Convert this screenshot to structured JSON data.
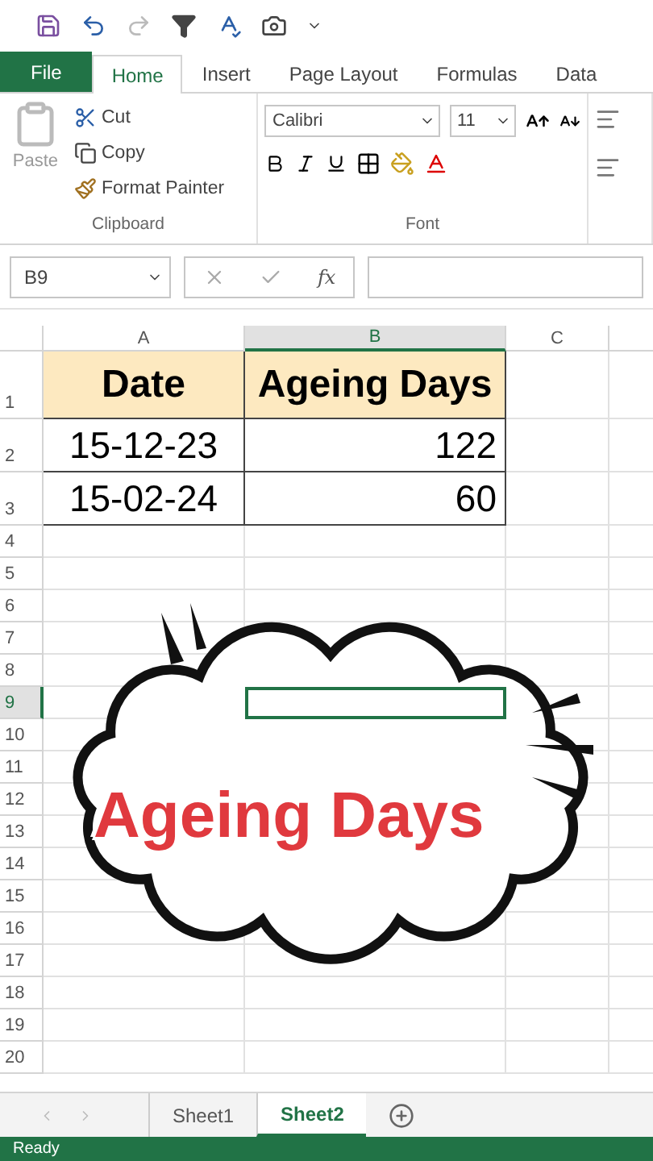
{
  "ribbon_tabs": [
    {
      "label": "File",
      "kind": "file",
      "selected": false
    },
    {
      "label": "Home",
      "kind": "tab",
      "selected": true
    },
    {
      "label": "Insert",
      "kind": "tab",
      "selected": false
    },
    {
      "label": "Page Layout",
      "kind": "tab",
      "selected": false
    },
    {
      "label": "Formulas",
      "kind": "tab",
      "selected": false
    },
    {
      "label": "Data",
      "kind": "tab",
      "selected": false
    }
  ],
  "clipboard": {
    "paste": "Paste",
    "cut": "Cut",
    "copy": "Copy",
    "format_painter": "Format Painter",
    "group": "Clipboard"
  },
  "font": {
    "name": "Calibri",
    "size": "11",
    "group": "Font"
  },
  "formula_bar": {
    "name_box": "B9",
    "function_label": "fx"
  },
  "columns": [
    {
      "label": "A",
      "selected": false
    },
    {
      "label": "B",
      "selected": true
    },
    {
      "label": "C",
      "selected": false
    }
  ],
  "rows": [
    {
      "number": "1",
      "selected": false,
      "kind": "header",
      "cells": [
        "Date",
        "Ageing Days"
      ]
    },
    {
      "number": "2",
      "selected": false,
      "kind": "data",
      "cells": [
        "15-12-23",
        "122"
      ]
    },
    {
      "number": "3",
      "selected": false,
      "kind": "data",
      "cells": [
        "15-02-24",
        "60"
      ]
    },
    {
      "number": "4",
      "selected": false,
      "kind": "empty"
    },
    {
      "number": "5",
      "selected": false,
      "kind": "empty"
    },
    {
      "number": "6",
      "selected": false,
      "kind": "empty"
    },
    {
      "number": "7",
      "selected": false,
      "kind": "empty"
    },
    {
      "number": "8",
      "selected": false,
      "kind": "empty"
    },
    {
      "number": "9",
      "selected": true,
      "kind": "empty"
    },
    {
      "number": "10",
      "selected": false,
      "kind": "empty"
    },
    {
      "number": "11",
      "selected": false,
      "kind": "empty"
    },
    {
      "number": "12",
      "selected": false,
      "kind": "empty"
    },
    {
      "number": "13",
      "selected": false,
      "kind": "empty"
    },
    {
      "number": "14",
      "selected": false,
      "kind": "empty"
    },
    {
      "number": "15",
      "selected": false,
      "kind": "empty"
    },
    {
      "number": "16",
      "selected": false,
      "kind": "empty"
    },
    {
      "number": "17",
      "selected": false,
      "kind": "empty"
    },
    {
      "number": "18",
      "selected": false,
      "kind": "empty"
    },
    {
      "number": "19",
      "selected": false,
      "kind": "empty"
    },
    {
      "number": "20",
      "selected": false,
      "kind": "empty"
    }
  ],
  "sheets": [
    {
      "label": "Sheet1",
      "selected": false
    },
    {
      "label": "Sheet2",
      "selected": true
    }
  ],
  "status_bar": "Ready",
  "overlay": {
    "caption": "Ageing Days"
  }
}
